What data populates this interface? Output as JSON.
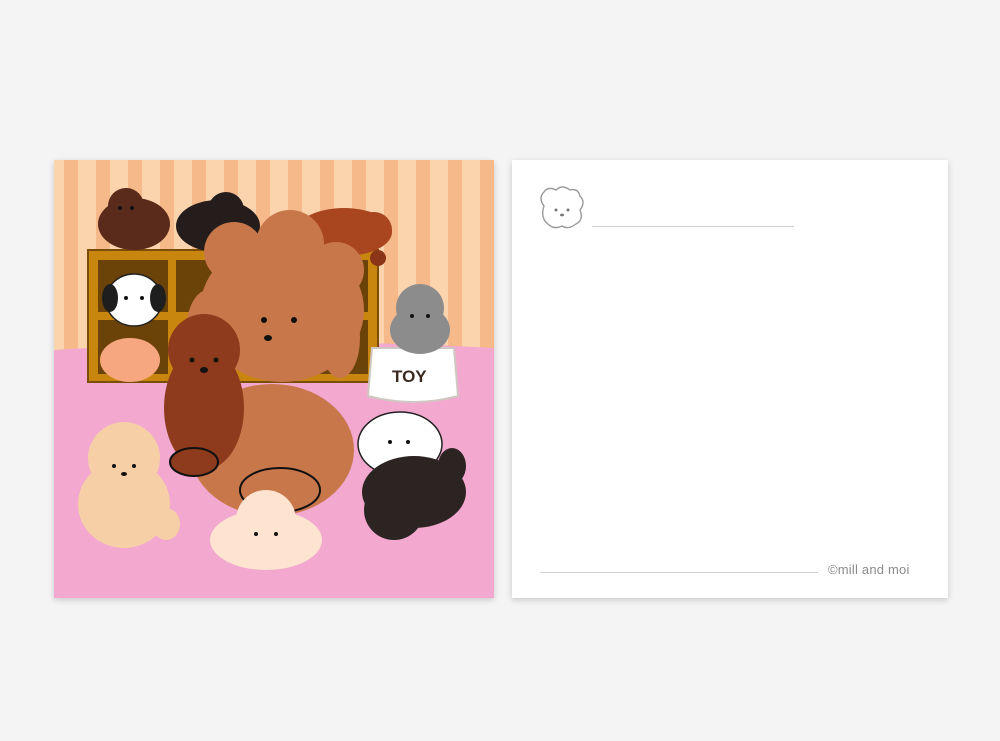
{
  "front": {
    "toy_box_label": "TOY"
  },
  "back": {
    "copyright": "©mill and moi",
    "logo_icon": "poodle-face-icon"
  },
  "colors": {
    "wall_stripe_light": "#fbd3ad",
    "wall_stripe_dark": "#f6b98a",
    "floor": "#f2a8cf",
    "shelf": "#c9860f",
    "big_poodle": "#c8774a",
    "red_poodle": "#8e3a1c",
    "black_poodle": "#2b2422",
    "cream_poodle": "#f6cfa6",
    "white_poodle": "#ffffff",
    "grey_poodle": "#8c8c8c"
  }
}
